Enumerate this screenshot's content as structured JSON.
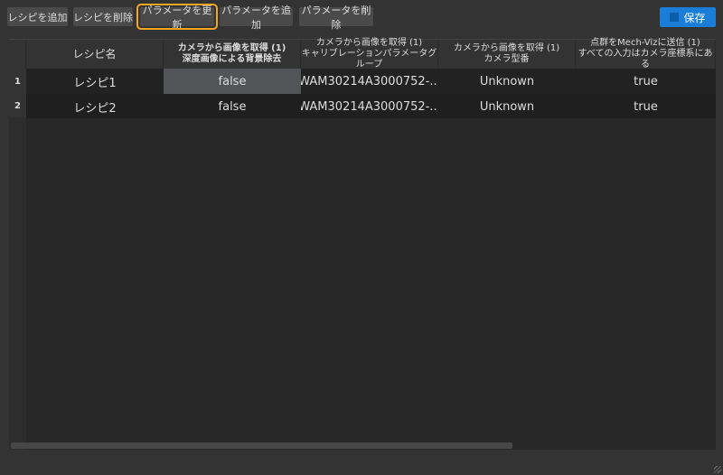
{
  "toolbar": {
    "buttons": [
      "レシピを追加",
      "レシピを削除",
      "パラメータを更新",
      "パラメータを追加",
      "パラメータを削除"
    ],
    "save": "保存",
    "save_icon": "save-icon"
  },
  "table": {
    "headers": [
      {
        "l1": "レシピ名",
        "l2": ""
      },
      {
        "l1": "カメラから画像を取得 (1)",
        "l2": "深度画像による背景除去"
      },
      {
        "l1": "カメラから画像を取得 (1)",
        "l2": "キャリブレーションパラメータグループ"
      },
      {
        "l1": "カメラから画像を取得 (1)",
        "l2": "カメラ型番"
      },
      {
        "l1": "点群をMech-Vizに送信 (1)",
        "l2": "すべての入力はカメラ座標系にある"
      }
    ],
    "rows": [
      {
        "num": "1",
        "cells": [
          "レシピ1",
          "false",
          "WAM30214A3000752-...",
          "Unknown",
          "true"
        ]
      },
      {
        "num": "2",
        "cells": [
          "レシピ2",
          "false",
          "WAM30214A3000752-...",
          "Unknown",
          "true"
        ]
      }
    ]
  }
}
